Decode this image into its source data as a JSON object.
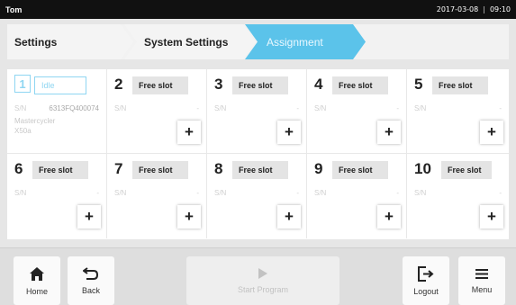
{
  "status": {
    "user": "Tom",
    "date": "2017-03-08",
    "separator": "|",
    "time": "09:10"
  },
  "breadcrumb": [
    "Settings",
    "System Settings",
    "Assignment"
  ],
  "slots": [
    {
      "number": "1",
      "label": "Idle",
      "sn_label": "S/N",
      "sn_value": "6313FQ400074",
      "model_line1": "Mastercycler",
      "model_line2": "X50a",
      "active": true
    },
    {
      "number": "2",
      "label": "Free slot",
      "sn_label": "S/N",
      "sn_value": "-",
      "add": "+"
    },
    {
      "number": "3",
      "label": "Free slot",
      "sn_label": "S/N",
      "sn_value": "-",
      "add": "+"
    },
    {
      "number": "4",
      "label": "Free slot",
      "sn_label": "S/N",
      "sn_value": "-",
      "add": "+"
    },
    {
      "number": "5",
      "label": "Free slot",
      "sn_label": "S/N",
      "sn_value": "-",
      "add": "+"
    },
    {
      "number": "6",
      "label": "Free slot",
      "sn_label": "S/N",
      "sn_value": "-",
      "add": "+"
    },
    {
      "number": "7",
      "label": "Free slot",
      "sn_label": "S/N",
      "sn_value": "-",
      "add": "+"
    },
    {
      "number": "8",
      "label": "Free slot",
      "sn_label": "S/N",
      "sn_value": "-",
      "add": "+"
    },
    {
      "number": "9",
      "label": "Free slot",
      "sn_label": "S/N",
      "sn_value": "-",
      "add": "+"
    },
    {
      "number": "10",
      "label": "Free slot",
      "sn_label": "S/N",
      "sn_value": "-",
      "add": "+"
    }
  ],
  "nav": {
    "home": "Home",
    "back": "Back",
    "start": "Start Program",
    "logout": "Logout",
    "menu": "Menu"
  },
  "colors": {
    "accent": "#5bc3ea",
    "statusbar": "#111111"
  },
  "icons": {
    "home": "home-icon",
    "back": "back-arrow-icon",
    "start": "play-icon",
    "logout": "logout-icon",
    "menu": "menu-icon"
  }
}
